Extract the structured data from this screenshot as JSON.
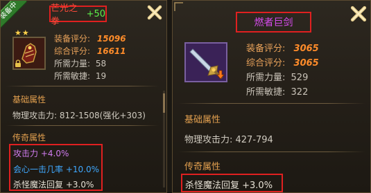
{
  "left": {
    "ribbon": "装备中",
    "title": {
      "name": "芒光之拳",
      "bonus": "+50"
    },
    "stars": 2,
    "stats": {
      "equip_score_label": "装备评分:",
      "equip_score": "15096",
      "total_score_label": "综合评分:",
      "total_score": "16611",
      "str_label": "所需力量:",
      "str": "58",
      "agi_label": "所需敏捷:",
      "agi": "19"
    },
    "basic_header": "基础属性",
    "basic_line": "物理攻击力: 812-1508(强化+303)",
    "legend_header": "传奇属性",
    "legend_lines": [
      {
        "text": "攻击力 +4.0%",
        "color": "#d07cf0"
      },
      {
        "text": "会心一击几率 +10.0%",
        "color": "#3fa9ff"
      },
      {
        "text": "杀怪魔法回复 +3.0%",
        "color": "#e6e1d5"
      }
    ]
  },
  "right": {
    "title": {
      "name": "燃者巨剑"
    },
    "stats": {
      "equip_score_label": "装备评分:",
      "equip_score": "3065",
      "total_score_label": "综合评分:",
      "total_score": "3065",
      "str_label": "所需力量:",
      "str": "529",
      "agi_label": "所需敏捷:",
      "agi": "322"
    },
    "basic_header": "基础属性",
    "basic_line": "物理攻击力: 427-794",
    "legend_header": "传奇属性",
    "legend_lines": [
      {
        "text": "杀怪魔法回复 +3.0%",
        "color": "#e6e1d5"
      }
    ]
  },
  "colors": {
    "highlight_box": "#e02020",
    "title_left": "#ff4a3a",
    "bonus_green": "#5cf04a",
    "title_right": "#d84cf0",
    "score_orange": "#ff8c2a"
  },
  "icons": [
    "close-icon",
    "gloves-item-icon",
    "lock-icon",
    "star-icon",
    "sword-item-icon",
    "downgrade-arrow-icon"
  ]
}
